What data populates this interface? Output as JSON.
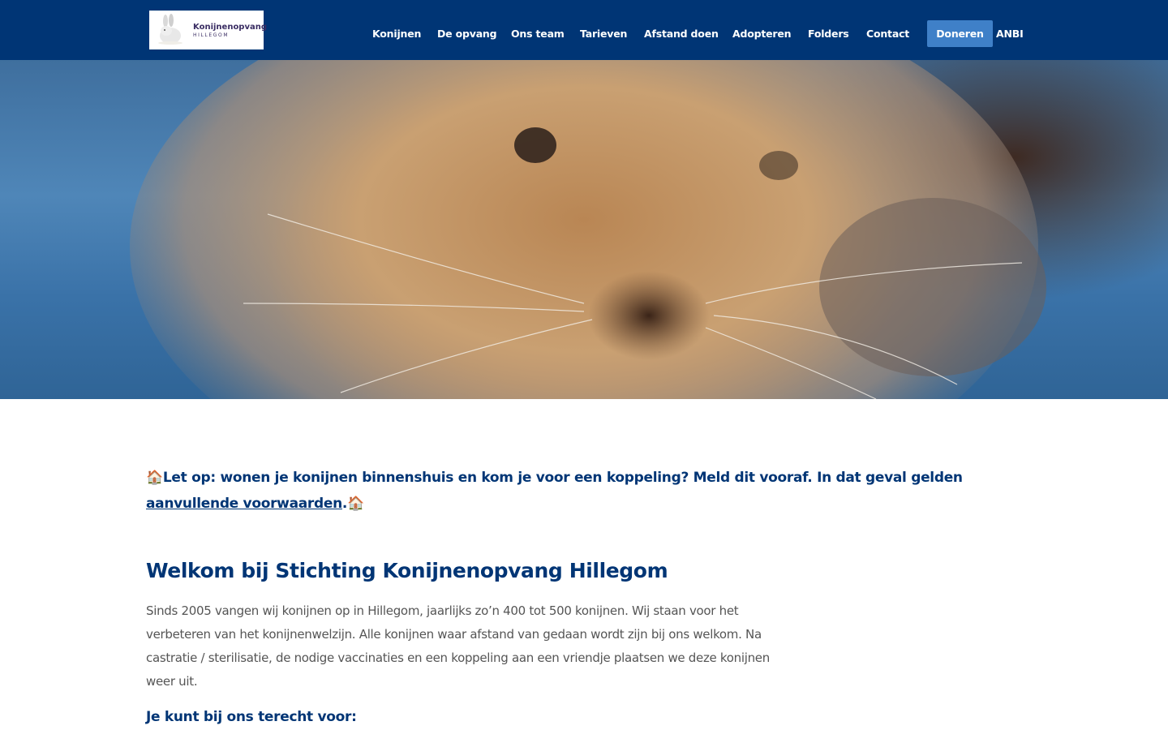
{
  "header": {
    "logo": {
      "name": "Konijnenopvang",
      "sub": "HILLEGOM"
    },
    "nav": [
      {
        "label": "Konijnen"
      },
      {
        "label": "De opvang"
      },
      {
        "label": "Ons team"
      },
      {
        "label": "Tarieven"
      },
      {
        "label": "Afstand doen"
      },
      {
        "label": "Adopteren"
      },
      {
        "label": "Folders"
      },
      {
        "label": "Contact"
      }
    ],
    "donate_label": "Doneren",
    "anbi_label": "ANBI"
  },
  "notice": {
    "icon": "🏠",
    "text": "Let op: wonen je konijnen binnenshuis en kom je voor een koppeling? Meld dit vooraf. In dat geval gelden ",
    "link": "aanvullende voorwaarden",
    "end": "."
  },
  "main": {
    "title": "Welkom bij Stichting Konijnenopvang Hillegom",
    "intro": "Sinds 2005 vangen wij konijnen op in Hillegom, jaarlijks zo’n 400 tot 500 konijnen. Wij staan voor het verbeteren van het konijnenwelzijn. Alle konijnen waar afstand van gedaan wordt zijn bij ons welkom. Na castratie / sterilisatie, de nodige vaccinaties en een koppeling aan een vriendje plaatsen we deze konijnen weer uit.",
    "subheading": "Je kunt bij ons terecht voor:"
  },
  "colors": {
    "brand": "#003575",
    "accent": "#3f80c8"
  }
}
